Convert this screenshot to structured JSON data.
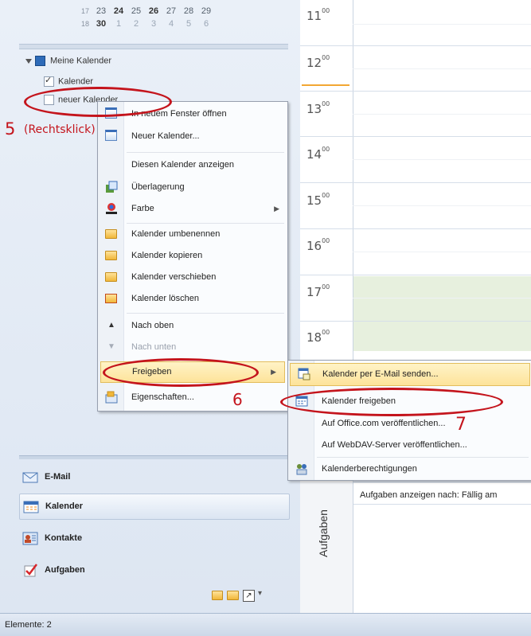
{
  "minical": {
    "rows": [
      {
        "week": "17",
        "days": [
          "23",
          "24",
          "25",
          "26",
          "27",
          "28",
          "29"
        ],
        "bold": [
          false,
          true,
          false,
          true,
          false,
          false,
          false
        ]
      },
      {
        "week": "18",
        "days": [
          "30",
          "1",
          "2",
          "3",
          "4",
          "5",
          "6"
        ],
        "bold": [
          true,
          false,
          false,
          false,
          false,
          false,
          false
        ]
      }
    ]
  },
  "tree": {
    "group_label": "Meine Kalender",
    "items": [
      {
        "label": "Kalender",
        "checked": true
      },
      {
        "label": "neuer Kalender",
        "checked": false
      }
    ]
  },
  "day_view": {
    "hours": [
      "11",
      "12",
      "13",
      "14",
      "15",
      "16",
      "17",
      "18"
    ],
    "minutes_suffix": "00"
  },
  "tasks": {
    "vertical_label": "Aufgaben",
    "header": "Aufgaben anzeigen nach: Fällig am"
  },
  "context_menu": {
    "items": [
      {
        "label": "In neuem Fenster öffnen",
        "icon": "open-window-icon"
      },
      {
        "label": "Neuer Kalender...",
        "icon": "new-calendar-icon"
      },
      {
        "label": "Diesen Kalender anzeigen",
        "icon": ""
      },
      {
        "label": "Überlagerung",
        "icon": "overlay-icon"
      },
      {
        "label": "Farbe",
        "icon": "color-icon",
        "submenu": true
      },
      {
        "label": "Kalender umbenennen",
        "icon": "rename-icon"
      },
      {
        "label": "Kalender kopieren",
        "icon": "copy-icon"
      },
      {
        "label": "Kalender verschieben",
        "icon": "move-icon"
      },
      {
        "label": "Kalender löschen",
        "icon": "delete-icon"
      },
      {
        "label": "Nach oben",
        "icon": "up-arrow-icon"
      },
      {
        "label": "Nach unten",
        "icon": "down-arrow-icon",
        "disabled": true
      },
      {
        "label": "Freigeben",
        "icon": "",
        "submenu": true,
        "highlighted": true
      },
      {
        "label": "Eigenschaften...",
        "icon": "properties-icon"
      }
    ]
  },
  "submenu": {
    "items": [
      {
        "label": "Kalender per E-Mail senden...",
        "icon": "email-calendar-icon",
        "highlighted": true
      },
      {
        "label": "Kalender freigeben",
        "icon": "share-calendar-icon"
      },
      {
        "label": "Auf Office.com veröffentlichen...",
        "icon": ""
      },
      {
        "label": "Auf WebDAV-Server veröffentlichen...",
        "icon": ""
      },
      {
        "label": "Kalenderberechtigungen",
        "icon": "permissions-icon"
      }
    ]
  },
  "nav_buttons": [
    {
      "label": "E-Mail",
      "icon": "mail-icon",
      "active": false
    },
    {
      "label": "Kalender",
      "icon": "calendar-icon",
      "active": true
    },
    {
      "label": "Kontakte",
      "icon": "contacts-icon",
      "active": false
    },
    {
      "label": "Aufgaben",
      "icon": "tasks-icon",
      "active": false
    }
  ],
  "statusbar": {
    "text": "Elemente: 2"
  },
  "annotations": {
    "step5": "5",
    "step5_note": "(Rechtsklick)",
    "step6": "6",
    "step7": "7"
  },
  "colors": {
    "annotation_red": "#c4141c",
    "highlight_yellow": "#fde39a",
    "now_line": "#f2a733",
    "free_time_green": "#e7f0de"
  }
}
